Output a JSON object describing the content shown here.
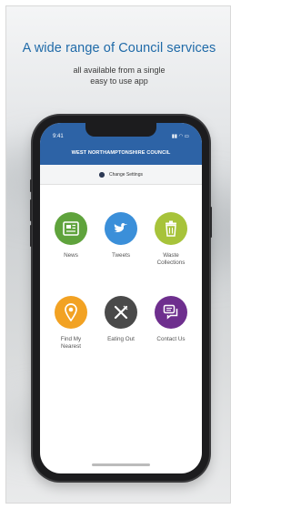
{
  "promo": {
    "headline": "A wide range of Council services",
    "subline_1": "all available from a single",
    "subline_2": "easy to use app"
  },
  "status_bar": {
    "time": "9:41",
    "icons": "▮▮ ◠ ▭"
  },
  "app": {
    "title": "WEST NORTHAMPTONSHIRE COUNCIL",
    "settings_label": "Change Settings",
    "tiles": [
      {
        "label_1": "News",
        "label_2": "",
        "icon": "newspaper-icon",
        "color": "#5fa33c"
      },
      {
        "label_1": "Tweets",
        "label_2": "",
        "icon": "twitter-bird-icon",
        "color": "#3b8fd9"
      },
      {
        "label_1": "Waste",
        "label_2": "Collections",
        "icon": "bin-icon",
        "color": "#a7c33a"
      },
      {
        "label_1": "Find My",
        "label_2": "Nearest",
        "icon": "location-pin-icon",
        "color": "#f2a223"
      },
      {
        "label_1": "Eating Out",
        "label_2": "",
        "icon": "cutlery-icon",
        "color": "#4a4a4a"
      },
      {
        "label_1": "Contact Us",
        "label_2": "",
        "icon": "chat-bubbles-icon",
        "color": "#6e2f8e"
      }
    ]
  },
  "colors": {
    "headline": "#1f6aa8",
    "appbar": "#2d63a6"
  }
}
